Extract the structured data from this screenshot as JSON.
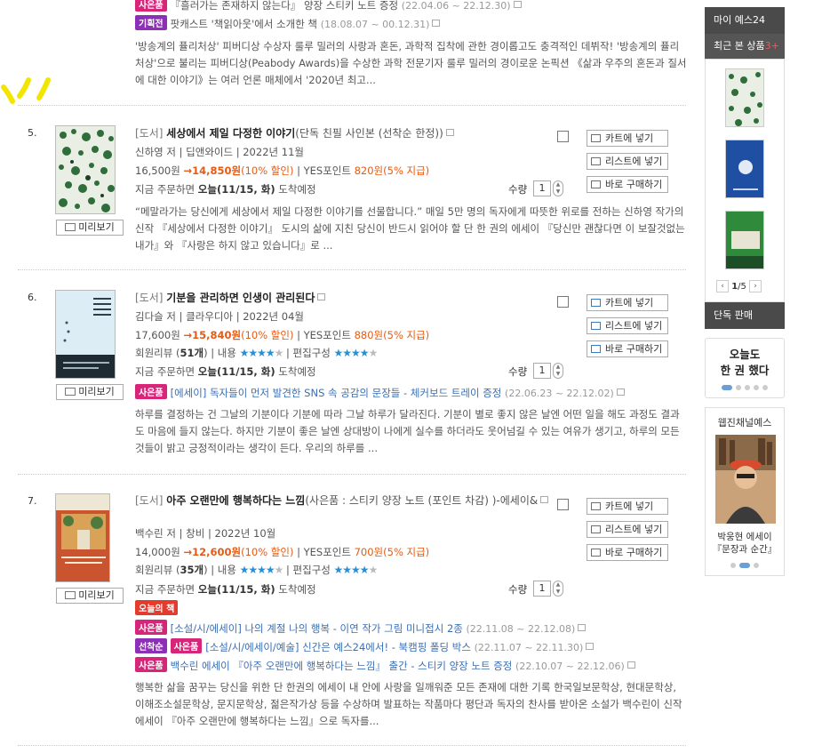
{
  "top_events": [
    {
      "tag": "사은품",
      "text": "『흘러가는 존재하지 않는다』 양장 스티키 노트 증정",
      "date": "(22.04.06 ~ 22.12.30)"
    },
    {
      "tag": "기획전",
      "text": "팟캐스트 '책읽아웃'에서 소개한 책",
      "date": "(18.08.07 ~ 00.12.31)"
    }
  ],
  "top_description": "'방송계의 퓰리처상' 피버디상 수상자 룰루 밀러의 사랑과 혼돈, 과학적 집착에 관한 경이롭고도 충격적인 데뷔작! '방송계의 퓰리처상'으로 불리는 피버디상(Peabody Awards)을 수상한 과학 전문기자 룰루 밀러의 경이로운 논픽션 《삶과 우주의 혼돈과 질서에 대한 이야기》는 여러 언론 매체에서 '2020년 최고...",
  "common": {
    "preview": "미리보기",
    "cart": "카트에 넣기",
    "list": "리스트에 넣기",
    "buy": "바로 구매하기",
    "qty_label": "수량",
    "qty": "1"
  },
  "items": [
    {
      "num": "5.",
      "category": "[도서]",
      "title": "세상에서 제일 다정한 이야기",
      "subtitle": "(단독 친필 사인본 (선착순 한정))",
      "author_line": "신하영 저 | 딥앤와이드 | 2022년 11월",
      "price": "16,500원",
      "sale_price": "→14,850원",
      "discount": "(10% 할인)",
      "points_label": " | YES포인트 ",
      "points": "820원",
      "points_pct": "(5% 지급)",
      "delivery_prefix": "지금 주문하면 ",
      "delivery_date": "오늘(11/15, 화)",
      "delivery_suffix": " 도착예정",
      "description": "“메말라가는 당신에게 세상에서 제일 다정한 이야기를 선물합니다.” 매일 5만 명의 독자에게 따뜻한 위로를 전하는 신하영 작가의 신작 『세상에서 다정한 이야기』 도시의 삶에 지친 당신이 반드시 읽어야 할 단 한 권의 에세이 『당신만 괜찮다면 이 보잘것없는 내가』와 『사랑은 하지 않고 있습니다』로 ..."
    },
    {
      "num": "6.",
      "category": "[도서]",
      "title": "기분을 관리하면 인생이 관리된다",
      "subtitle": "",
      "author_line": "김다슬 저 | 클라우디아 | 2022년 04월",
      "price": "17,600원",
      "sale_price": "→15,840원",
      "discount": "(10% 할인)",
      "points_label": " | YES포인트 ",
      "points": "880원",
      "points_pct": "(5% 지급)",
      "review_label": "회원리뷰 (",
      "review_count": "51개",
      "review_suffix": ") | 내용 ",
      "composition_label": " | 편집구성 ",
      "content_rating": 4.5,
      "composition_rating": 4.5,
      "delivery_prefix": "지금 주문하면 ",
      "delivery_date": "오늘(11/15, 화)",
      "delivery_suffix": " 도착예정",
      "event": {
        "tag": "사은품",
        "text": "[에세이] 독자들이 먼저 발견한 SNS 속 공감의 문장들 - 체커보드 트레이 증정",
        "date": "(22.06.23 ~ 22.12.02)"
      },
      "description": "하루를 결정하는 건 그날의 기분이다 기분에 따라 그날 하루가 달라진다. 기분이 별로 좋지 않은 날엔 어떤 일을 해도 과정도 결과도 마음에 들지 않는다. 하지만 기분이 좋은 날엔 상대방이 나에게 실수를 하더라도 웃어넘길 수 있는 여유가 생기고, 하루의 모든 것들이 밝고 긍정적이라는 생각이 든다. 우리의 하루를 ..."
    },
    {
      "num": "7.",
      "category": "[도서]",
      "title": "아주 오랜만에 행복하다는 느낌",
      "subtitle": "(사은품 : 스티키 양장 노트 (포인트 차감) )-에세이&",
      "author_line": "백수린 저 | 창비 | 2022년 10월",
      "price": "14,000원",
      "sale_price": "→12,600원",
      "discount": "(10% 할인)",
      "points_label": " | YES포인트 ",
      "points": "700원",
      "points_pct": "(5% 지급)",
      "review_label": "회원리뷰 (",
      "review_count": "35개",
      "review_suffix": ") | 내용 ",
      "composition_label": " | 편집구성 ",
      "content_rating": 4.5,
      "composition_rating": 4.5,
      "delivery_prefix": "지금 주문하면 ",
      "delivery_date": "오늘(11/15, 화)",
      "delivery_suffix": " 도착예정",
      "badge": "오늘의 책",
      "events": [
        {
          "tags": [
            "사은품"
          ],
          "text": "[소설/시/에세이] 나의 계절 나의 행복 - 이연 작가 그림 미니접시 2종",
          "date": "(22.11.08 ~ 22.12.08)"
        },
        {
          "tags": [
            "선착순",
            "사은품"
          ],
          "text": "[소설/시/에세이/예술] 신간은 예스24에서! - 북캠핑 폴딩 박스",
          "date": "(22.11.07 ~ 22.11.30)"
        },
        {
          "tags": [
            "사은품"
          ],
          "text": "백수린 에세이 『아주 오랜만에 행복하다는 느낌』 출간 - 스티키 양장 노트 증정",
          "date": "(22.10.07 ~ 22.12.06)"
        }
      ],
      "description": "행복한 삶을 꿈꾸는 당신을 위한 단 한권의 에세이 내 안에 사랑을 일깨워준 모든 존재에 대한 기록 한국일보문학상, 현대문학상, 이해조소설문학상, 문지문학상, 젊은작가상 등을 수상하며 발표하는 작품마다 평단과 독자의 찬사를 받아온 소설가 백수린이 신작 에세이 『아주 오랜만에 행복하다는 느낌』으로 독자를..."
    }
  ],
  "sidebar": {
    "my_yes": "마이 예스24",
    "recent_label": "최근 본 상품",
    "recent_count": "3+",
    "page_current": "1",
    "page_total": "/5",
    "exclusive": "단독 판매",
    "today_line1": "오늘도",
    "today_line2": "한 권 했다",
    "channel_title": "웹진채널예스",
    "channel_caption1": "박웅현 에세이",
    "channel_caption2": "『문장과 순간』"
  },
  "colors": {
    "sale": "#e55b13",
    "star": "#2c8dd0",
    "tag_pink": "#d7267a",
    "tag_purple": "#8e2fb8",
    "dark": "#4a4a4a"
  }
}
